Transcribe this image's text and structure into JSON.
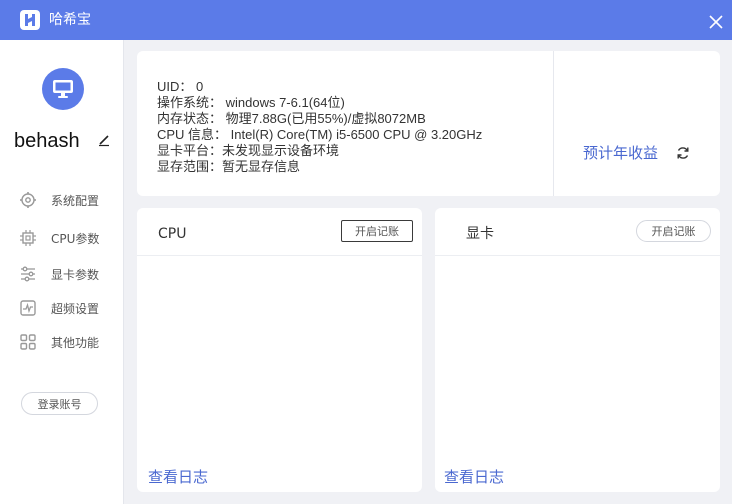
{
  "app": {
    "title": "哈希宝",
    "accent_color": "#5b7be8"
  },
  "sidebar": {
    "username": "behash",
    "items": [
      {
        "label": "系统配置",
        "icon": "gear-icon"
      },
      {
        "label": "CPU参数",
        "icon": "chip-icon"
      },
      {
        "label": "显卡参数",
        "icon": "sliders-icon"
      },
      {
        "label": "超频设置",
        "icon": "pulse-icon"
      },
      {
        "label": "其他功能",
        "icon": "grid-icon"
      }
    ],
    "login_label": "登录账号"
  },
  "info": {
    "uid": "UID： 0",
    "os": "操作系统： windows 7-6.1(64位)",
    "memory": "内存状态： 物理7.88G(已用55%)/虚拟8072MB",
    "cpu": "CPU 信息： Intel(R) Core(TM) i5-6500 CPU @ 3.20GHz",
    "gpu_platform": "显卡平台：未发现显示设备环境",
    "vram": "显存范围：暂无显存信息",
    "earnings_label": "预计年收益"
  },
  "panels": {
    "cpu": {
      "title": "CPU",
      "record_label": "开启记账",
      "log_label": "查看日志"
    },
    "gpu": {
      "title": "显卡",
      "record_label": "开启记账",
      "log_label": "查看日志"
    }
  }
}
